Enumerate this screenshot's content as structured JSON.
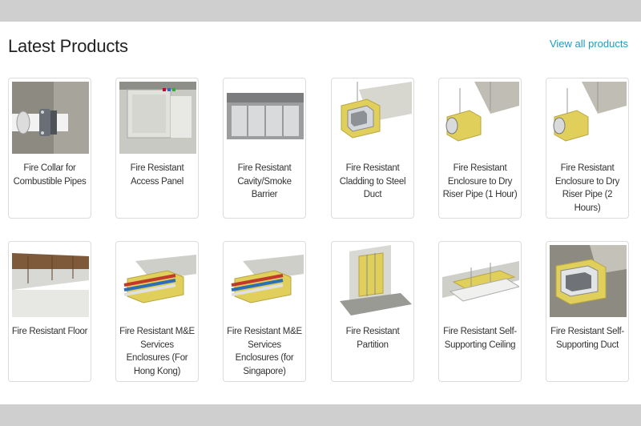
{
  "section": {
    "title": "Latest Products",
    "view_all": "View all products"
  },
  "products": [
    {
      "name": "Fire Collar for Combustible Pipes",
      "icon": "fire-collar-pipe-image"
    },
    {
      "name": "Fire Resistant Access Panel",
      "icon": "access-panel-image"
    },
    {
      "name": "Fire Resistant Cavity/Smoke Barrier",
      "icon": "cavity-barrier-image"
    },
    {
      "name": "Fire Resistant Cladding to Steel Duct",
      "icon": "cladding-duct-image"
    },
    {
      "name": "Fire Resistant Enclosure to Dry Riser Pipe (1 Hour)",
      "icon": "riser-pipe-1h-image"
    },
    {
      "name": "Fire Resistant Enclosure to Dry Riser Pipe (2 Hours)",
      "icon": "riser-pipe-2h-image"
    },
    {
      "name": "Fire Resistant Floor",
      "icon": "fire-floor-image"
    },
    {
      "name": "Fire Resistant M&E Services Enclosures (For Hong Kong)",
      "icon": "me-enclosure-hk-image"
    },
    {
      "name": "Fire Resistant M&E Services Enclosures (for Singapore)",
      "icon": "me-enclosure-sg-image"
    },
    {
      "name": "Fire Resistant Partition",
      "icon": "partition-image"
    },
    {
      "name": "Fire Resistant Self-Supporting Ceiling",
      "icon": "self-supporting-ceiling-image"
    },
    {
      "name": "Fire Resistant Self-Supporting Duct",
      "icon": "self-supporting-duct-image"
    }
  ],
  "colors": {
    "accent": "#1d9bc6",
    "background": "#cfcfcf",
    "insulation": "#e0cf5a"
  }
}
